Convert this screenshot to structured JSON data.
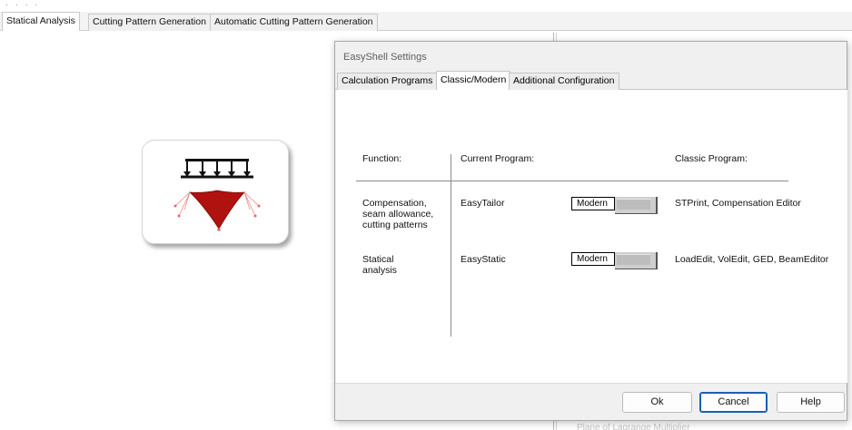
{
  "window": {
    "main_tabs": [
      {
        "label": "Statical Analysis",
        "active": true
      },
      {
        "label": "Cutting Pattern Generation",
        "active": false
      },
      {
        "label": "Automatic Cutting Pattern Generation",
        "active": false
      }
    ],
    "background_text": "Plane of Lagrange Multiplier",
    "module_icon": "statical-analysis-membrane-icon"
  },
  "dialog": {
    "title": "EasyShell Settings",
    "tabs": [
      {
        "label": "Calculation Programs",
        "active": false
      },
      {
        "label": "Classic/Modern",
        "active": true
      },
      {
        "label": "Additional Configuration",
        "active": false
      }
    ],
    "columns": {
      "function": "Function:",
      "current": "Current Program:",
      "classic": "Classic Program:"
    },
    "rows": [
      {
        "function_lines": [
          "Compensation,",
          "seam allowance,",
          "cutting patterns"
        ],
        "current": "EasyTailor",
        "toggle": "Modern",
        "classic": "STPrint, Compensation Editor"
      },
      {
        "function_lines": [
          "Statical",
          "analysis"
        ],
        "current": "EasyStatic",
        "toggle": "Modern",
        "classic": "LoadEdit, VolEdit, GED, BeamEditor"
      }
    ],
    "buttons": {
      "ok": "Ok",
      "cancel": "Cancel",
      "help": "Help"
    },
    "colors": {
      "membrane": "#b0120f",
      "default_button_border": "#1b5fb5"
    }
  }
}
